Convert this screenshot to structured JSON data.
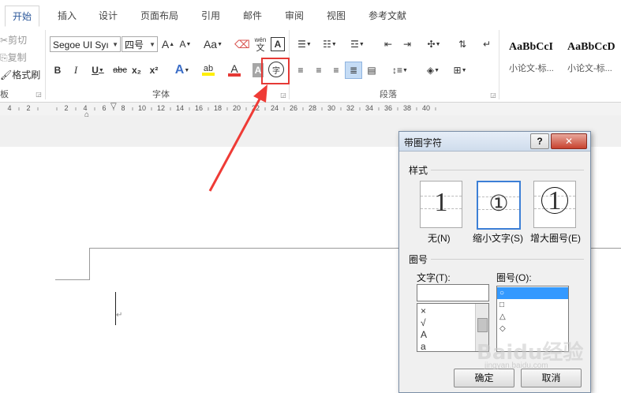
{
  "tabs": [
    {
      "label": "开始"
    },
    {
      "label": "插入"
    },
    {
      "label": "设计"
    },
    {
      "label": "页面布局"
    },
    {
      "label": "引用"
    },
    {
      "label": "邮件"
    },
    {
      "label": "审阅"
    },
    {
      "label": "视图"
    },
    {
      "label": "参考文献"
    }
  ],
  "clipboard": {
    "cut": "剪切",
    "copy": "复制",
    "format_painter": "格式刷",
    "group_label": "板"
  },
  "font": {
    "name": "Segoe UI Syı",
    "size": "四号",
    "group_label": "字体",
    "bold": "B",
    "italic": "I",
    "underline": "U",
    "strike": "abc",
    "subscript": "x₂",
    "superscript": "x²",
    "phonetic_top": "wén",
    "phonetic_bottom": "文",
    "enclosed_char": "字",
    "char_border": "A",
    "grow": "A",
    "shrink": "A",
    "change_case": "Aa",
    "font_color": "A",
    "highlight": "ab",
    "text_effect": "A",
    "shading": "A"
  },
  "paragraph": {
    "group_label": "段落"
  },
  "styles": [
    {
      "preview": "AaBbCcI",
      "name": "小论文-标..."
    },
    {
      "preview": "AaBbCcD",
      "name": "小论文-标..."
    }
  ],
  "ruler": {
    "labels": [
      "4",
      "2",
      "",
      "2",
      "4",
      "6",
      "8",
      "10",
      "12",
      "14",
      "16",
      "18",
      "20",
      "22",
      "24",
      "26",
      "28",
      "30",
      "32",
      "34",
      "36",
      "38",
      "40"
    ]
  },
  "dialog": {
    "title": "带圈字符",
    "help": "?",
    "close": "✕",
    "style_section": "样式",
    "style_options": [
      {
        "label": "无(N)",
        "char": "1"
      },
      {
        "label": "缩小文字(S)",
        "char": "①"
      },
      {
        "label": "增大圈号(E)",
        "char": "1"
      }
    ],
    "enclosure_section": "圈号",
    "text_label": "文字(T):",
    "ring_label": "圈号(O):",
    "text_value": "",
    "text_list": [
      "×",
      "√",
      "A",
      "a"
    ],
    "ring_list": [
      "○",
      "□",
      "△",
      "◇"
    ],
    "ok": "确定",
    "cancel": "取消"
  },
  "watermark": {
    "text": "Baidu经验",
    "sub": "jingyan.baidu.com"
  },
  "colors": {
    "accent": "#2b579a",
    "highlight_box": "#e53935",
    "arrow": "#ef3b36",
    "selection": "#3399ff"
  }
}
